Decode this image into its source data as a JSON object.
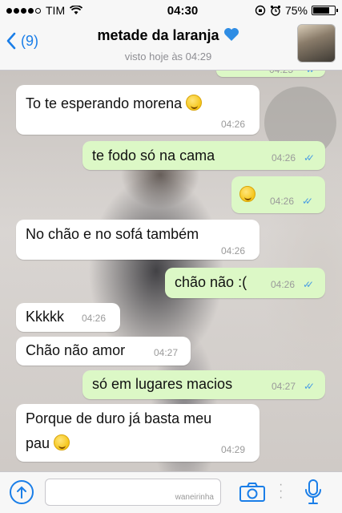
{
  "status_bar": {
    "carrier": "TIM",
    "time": "04:30",
    "battery": "75%",
    "battery_level": 0.75
  },
  "header": {
    "back_label": "(9)",
    "title": "metade da laranja",
    "subtitle": "visto hoje às 04:29"
  },
  "messages": [
    {
      "dir": "in",
      "text": "To te esperando morena",
      "emoji": true,
      "time": "04:26"
    },
    {
      "dir": "out",
      "text": "te fodo só na cama",
      "emoji": false,
      "time": "04:26",
      "ticks": "✓✓"
    },
    {
      "dir": "out",
      "text": "",
      "emoji": true,
      "time": "04:26",
      "ticks": "✓✓"
    },
    {
      "dir": "in",
      "text": "No chão e no sofá também",
      "emoji": false,
      "time": "04:26"
    },
    {
      "dir": "out",
      "text": "chão não :(",
      "emoji": false,
      "time": "04:26",
      "ticks": "✓✓"
    },
    {
      "dir": "in",
      "text": "Kkkkk",
      "emoji": false,
      "time": "04:26"
    },
    {
      "dir": "in",
      "text": "Chão não amor",
      "emoji": false,
      "time": "04:27"
    },
    {
      "dir": "out",
      "text": "só em lugares macios",
      "emoji": false,
      "time": "04:27",
      "ticks": "✓✓"
    },
    {
      "dir": "in",
      "text": "Porque de duro já basta meu",
      "text2": "pau",
      "emoji": true,
      "time": "04:29"
    }
  ],
  "partial_top_time": "04:25",
  "input": {
    "watermark": "waneirinha"
  }
}
